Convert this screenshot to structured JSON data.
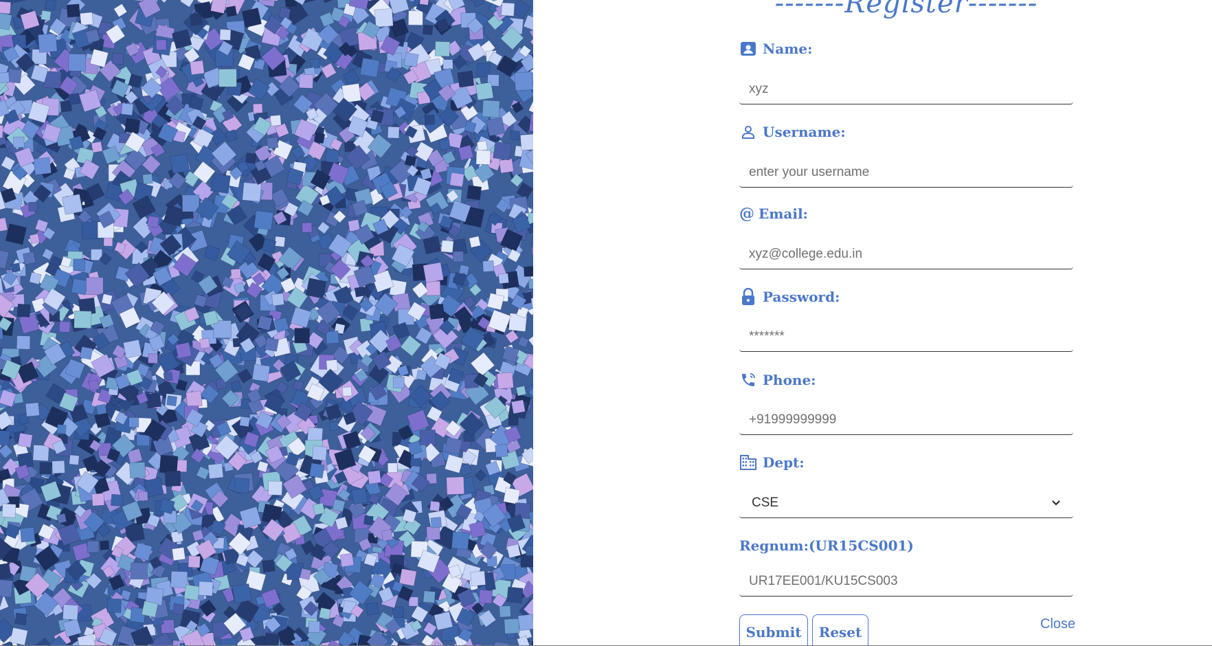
{
  "form": {
    "title": "-------Register-------",
    "name": {
      "label": "Name:",
      "placeholder": "xyz",
      "icon": "contact-card-icon"
    },
    "username": {
      "label": "Username:",
      "placeholder": "enter your username",
      "icon": "person-outline-icon"
    },
    "email": {
      "label": "Email:",
      "prefix": "@",
      "placeholder": "xyz@college.edu.in",
      "icon": "at-icon"
    },
    "password": {
      "label": "Password:",
      "placeholder": "*******",
      "icon": "lock-icon"
    },
    "phone": {
      "label": "Phone:",
      "placeholder": "+91999999999",
      "icon": "phone-in-talk-icon"
    },
    "dept": {
      "label": "Dept:",
      "selected": "CSE",
      "icon": "building-icon"
    },
    "regnum": {
      "label": "Regnum:(UR15CS001)",
      "placeholder": "UR17EE001/KU15CS003"
    },
    "buttons": {
      "submit": "Submit",
      "reset": "Reset",
      "close": "Close"
    }
  },
  "colors": {
    "accent": "#4a78c9",
    "glitter_base": "#3d5f9a"
  }
}
